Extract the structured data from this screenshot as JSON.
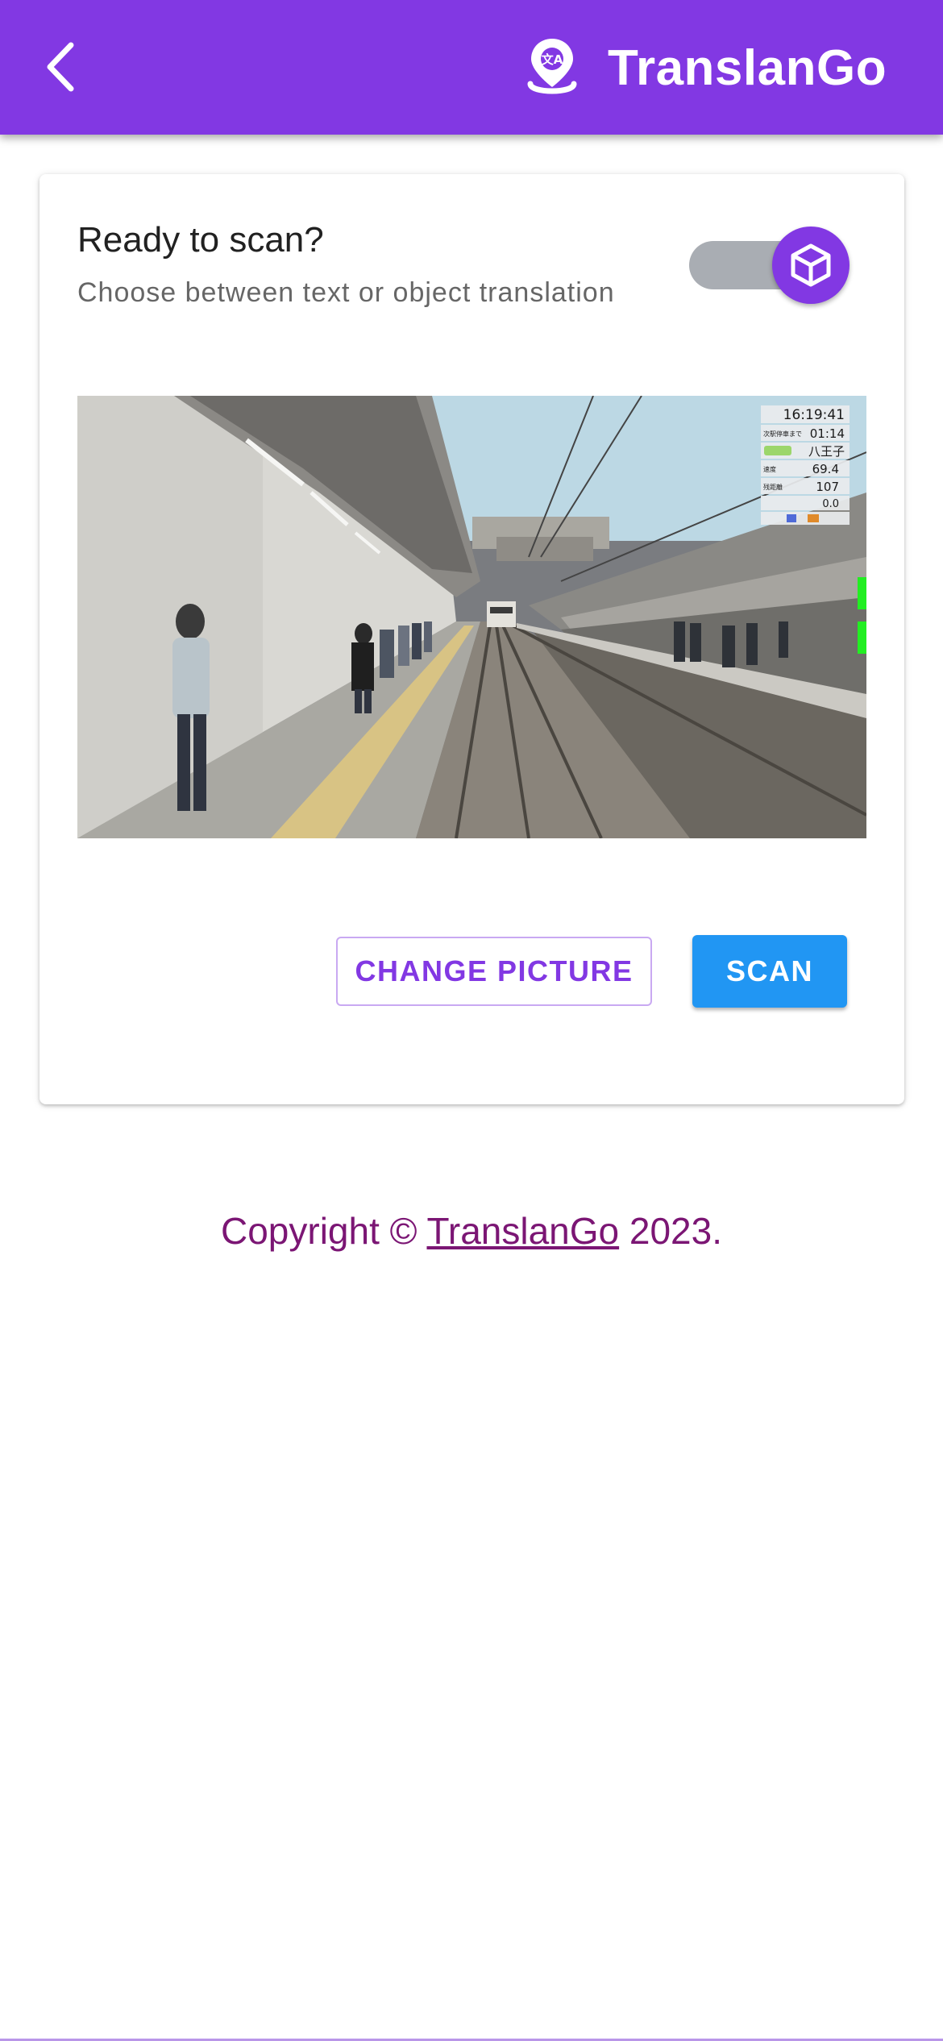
{
  "app_bar": {
    "title": "TranslanGo",
    "color": "#8238e3",
    "back_icon": "chevron-left-icon",
    "brand_icon": "map-pin-translate-icon"
  },
  "card": {
    "title": "Ready to scan?",
    "subtitle": "Choose between text or object translation",
    "toggle": {
      "icon": "cube-icon",
      "state": "object"
    },
    "preview": {
      "overlay_time": "16:19:41",
      "overlay_row1_label": "次駅停車まで",
      "overlay_row1_value": "01:14",
      "overlay_row2_label": "八王子",
      "overlay_row3_label": "速度",
      "overlay_row3_value": "69.4",
      "overlay_row4_label": "残距離",
      "overlay_row4_value": "107",
      "overlay_row5_value": "0.0"
    },
    "change_picture_label": "CHANGE PICTURE",
    "scan_label": "SCAN"
  },
  "footer": {
    "prefix": "Copyright ©",
    "link_text": "TranslanGo",
    "suffix": "2023."
  },
  "colors": {
    "primary": "#8238e3",
    "scan_button": "#2196f3",
    "copyright": "#7b1674"
  }
}
